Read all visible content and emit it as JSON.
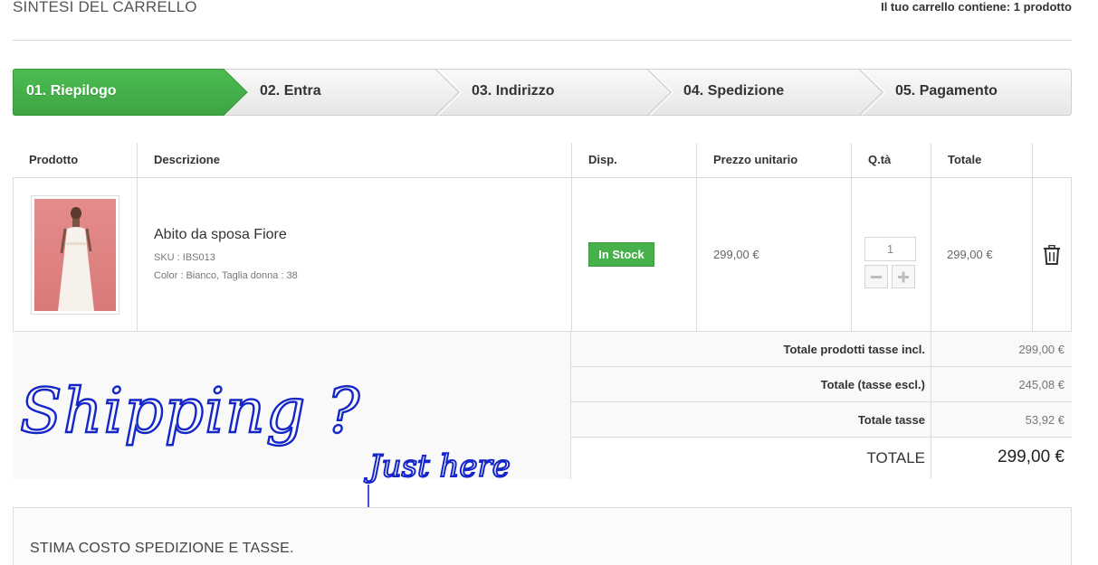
{
  "header": {
    "title": "SINTESI DEL CARRELLO",
    "cart_summary": "Il tuo carrello contiene: 1 prodotto"
  },
  "steps": [
    {
      "label": "01. Riepilogo",
      "active": true
    },
    {
      "label": "02. Entra",
      "active": false
    },
    {
      "label": "03. Indirizzo",
      "active": false
    },
    {
      "label": "04. Spedizione",
      "active": false
    },
    {
      "label": "05. Pagamento",
      "active": false
    }
  ],
  "table": {
    "headers": [
      "Prodotto",
      "Descrizione",
      "Disp.",
      "Prezzo unitario",
      "Q.tà",
      "Totale"
    ],
    "item": {
      "name": "Abito da sposa Fiore",
      "sku": "SKU : IBS013",
      "attributes": "Color : Bianco, Taglia donna : 38",
      "availability": "In Stock",
      "unit_price": "299,00 €",
      "quantity": "1",
      "total": "299,00 €"
    }
  },
  "summary": [
    {
      "label": "Totale prodotti tasse incl.",
      "value": "299,00 €"
    },
    {
      "label": "Totale (tasse escl.)",
      "value": "245,08 €"
    },
    {
      "label": "Totale tasse",
      "value": "53,92 €"
    },
    {
      "label": "TOTALE",
      "value": "299,00 €"
    }
  ],
  "annotations": {
    "handwriting_1": "Shipping ?",
    "handwriting_2": "Just here"
  },
  "shipping_estimate": {
    "title": "STIMA COSTO SPEDIZIONE E TASSE."
  },
  "colors": {
    "active_step": "#46b04a",
    "in_stock": "#46b04a",
    "annotation_ink": "#1426c8"
  },
  "icons": [
    "trash-icon",
    "minus-icon",
    "plus-icon"
  ]
}
